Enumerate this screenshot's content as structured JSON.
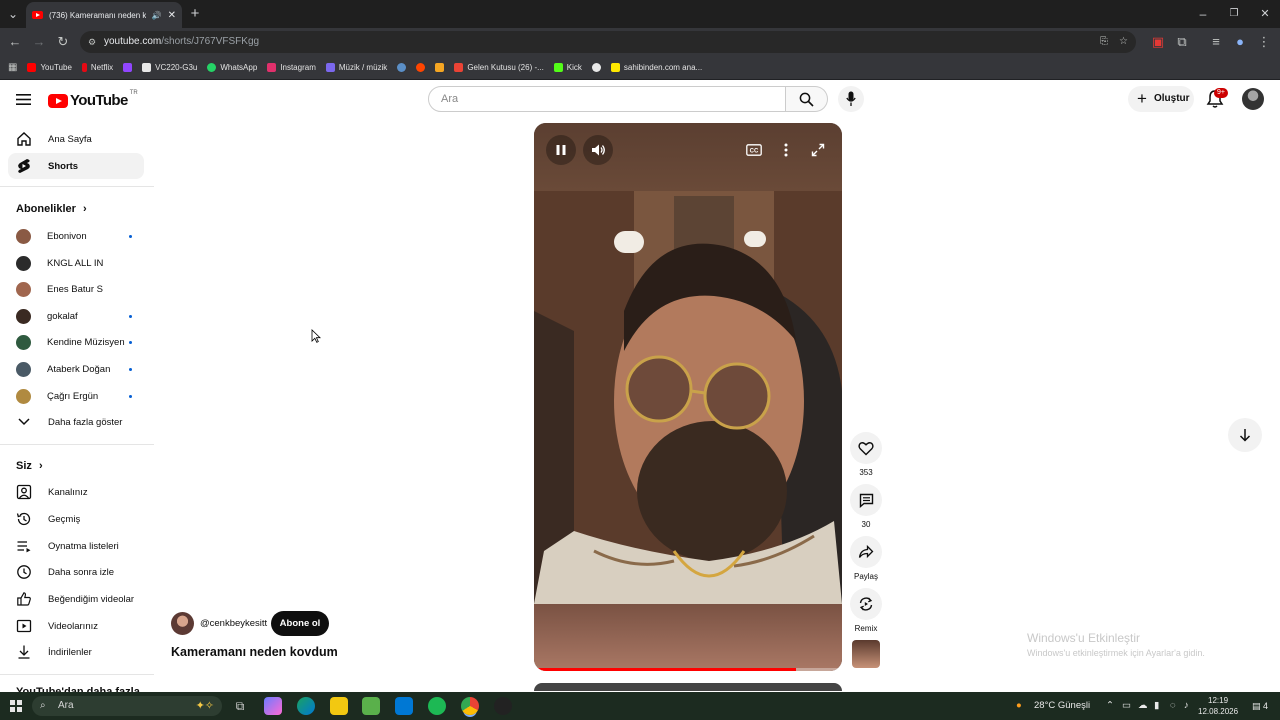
{
  "browser": {
    "tab_title": "(736) Kameramanı neden ko",
    "url_domain": "youtube.com",
    "url_path": "/shorts/J767VFSFKgg",
    "bookmarks": [
      "YouTube",
      "Netflix",
      "VC220-G3u",
      "WhatsApp",
      "Instagram",
      "Müzik / müzik",
      "Gelen Kutusu (26) -...",
      "Kick",
      "sahibinden.com ana..."
    ],
    "bookmark_colors": [
      "#ff0000",
      "#e50914",
      "#9146ff",
      "#e8e8e8",
      "#25d366",
      "#e1306c",
      "#7b68ee",
      "#1b2838",
      "#ff4500",
      "#f5a623",
      "#ea4335",
      "#53fc18",
      "#e8e8e8",
      "#ffe800"
    ]
  },
  "masthead": {
    "logo_text": "YouTube",
    "logo_region": "TR",
    "search_placeholder": "Ara",
    "create_label": "Oluştur",
    "notification_count": "9+"
  },
  "sidebar": {
    "main": [
      {
        "label": "Ana Sayfa",
        "icon": "home-icon"
      },
      {
        "label": "Shorts",
        "icon": "shorts-icon"
      }
    ],
    "subscriptions_title": "Abonelikler",
    "subscriptions": [
      {
        "label": "Ebonivon",
        "new": true,
        "color": "#8a5a44"
      },
      {
        "label": "KNGL ALL IN",
        "new": false,
        "color": "#2b2b2b"
      },
      {
        "label": "Enes Batur S",
        "new": false,
        "color": "#a0664e"
      },
      {
        "label": "gokalaf",
        "new": true,
        "color": "#3a2a22"
      },
      {
        "label": "Kendine Müzisyen",
        "new": true,
        "color": "#2f5a3f"
      },
      {
        "label": "Ataberk Doğan",
        "new": true,
        "color": "#4a5a66"
      },
      {
        "label": "Çağrı Ergün",
        "new": true,
        "color": "#b08a40"
      }
    ],
    "show_more": "Daha fazla göster",
    "you_title": "Siz",
    "you_items": [
      {
        "label": "Kanalınız",
        "icon": "channel-icon"
      },
      {
        "label": "Geçmiş",
        "icon": "history-icon"
      },
      {
        "label": "Oynatma listeleri",
        "icon": "playlists-icon"
      },
      {
        "label": "Daha sonra izle",
        "icon": "watch-later-icon"
      },
      {
        "label": "Beğendiğim videolar",
        "icon": "liked-icon"
      },
      {
        "label": "Videolarınız",
        "icon": "your-videos-icon"
      },
      {
        "label": "İndirilenler",
        "icon": "downloads-icon"
      }
    ],
    "more_section_cut": "YouTube'dan daha fazla"
  },
  "short": {
    "channel": "@cenkbeykesitt",
    "subscribe_label": "Abone ol",
    "title": "Kameramanı neden kovdum",
    "progress": 0.85,
    "likes": "353",
    "comments": "30",
    "share_label": "Paylaş",
    "remix_label": "Remix"
  },
  "watermark": {
    "line1": "Windows'u Etkinleştir",
    "line2": "Windows'u etkinleştirmek için Ayarlar'a gidin."
  },
  "taskbar": {
    "search_label": "Ara",
    "weather": "28°C  Güneşli",
    "time": "12:19",
    "date": "12.08.2026",
    "notifications": "4",
    "app_colors": [
      "#6b7bff",
      "#1aa260",
      "#0078d4",
      "#f2c811",
      "#5ab04b",
      "#0078d4",
      "#1db954",
      "#4285f4",
      "#222222"
    ]
  }
}
